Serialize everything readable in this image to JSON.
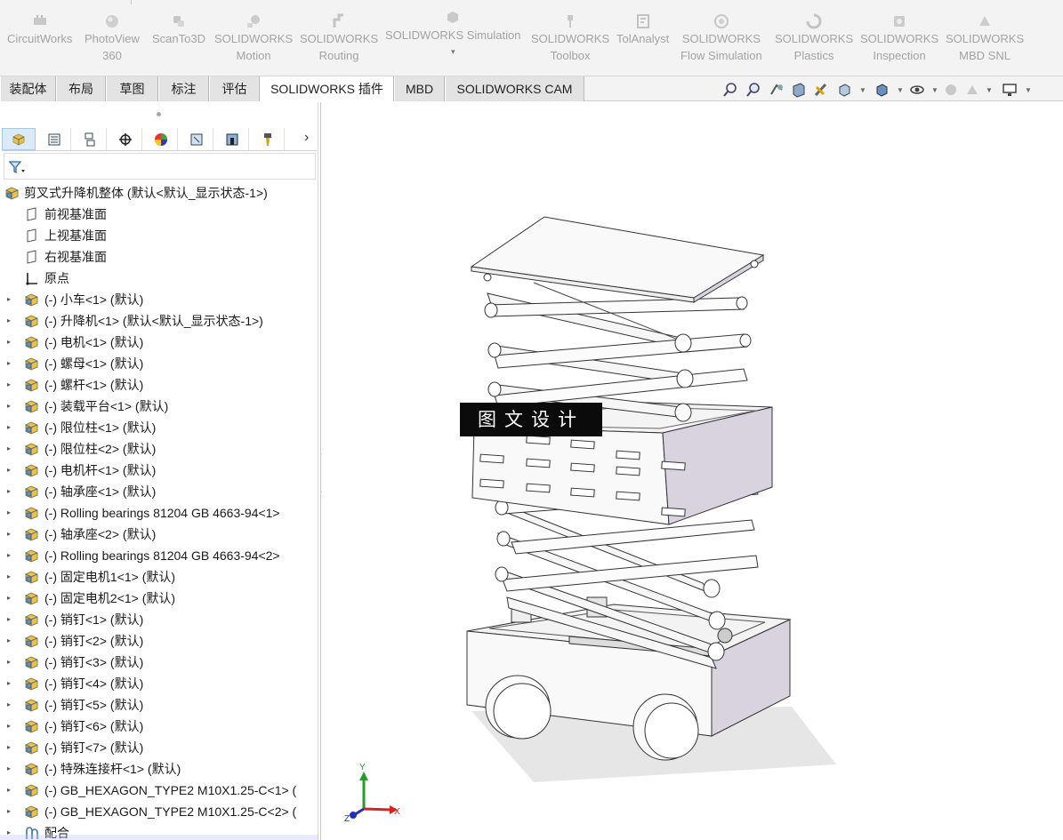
{
  "ribbon": {
    "addins": [
      {
        "line1": "CircuitWorks",
        "line2": ""
      },
      {
        "line1": "PhotoView",
        "line2": "360"
      },
      {
        "line1": "ScanTo3D",
        "line2": ""
      },
      {
        "line1": "SOLIDWORKS",
        "line2": "Motion"
      },
      {
        "line1": "SOLIDWORKS",
        "line2": "Routing"
      },
      {
        "line1": "SOLIDWORKS Simulation",
        "line2": ""
      },
      {
        "line1": "SOLIDWORKS",
        "line2": "Toolbox"
      },
      {
        "line1": "TolAnalyst",
        "line2": ""
      },
      {
        "line1": "SOLIDWORKS",
        "line2": "Flow Simulation"
      },
      {
        "line1": "SOLIDWORKS",
        "line2": "Plastics"
      },
      {
        "line1": "SOLIDWORKS",
        "line2": "Inspection"
      },
      {
        "line1": "SOLIDWORKS",
        "line2": "MBD SNL"
      }
    ],
    "simulation_caret": "▾"
  },
  "tabs": [
    {
      "label": "装配体"
    },
    {
      "label": "布局"
    },
    {
      "label": "草图"
    },
    {
      "label": "标注"
    },
    {
      "label": "评估"
    },
    {
      "label": "SOLIDWORKS 插件",
      "active": true
    },
    {
      "label": "MBD"
    },
    {
      "label": "SOLIDWORKS CAM"
    }
  ],
  "view_tools": [
    "zoom-to-fit-icon",
    "zoom-to-area-icon",
    "previous-view-icon",
    "section-view-icon",
    "dynamic-annotation-icon",
    "view-orientation-icon",
    "display-style-icon",
    "hide-show-items-icon",
    "edit-appearance-icon",
    "apply-scene-icon",
    "view-settings-icon"
  ],
  "feature_manager": {
    "tabs": [
      "feature-manager-icon",
      "property-manager-icon",
      "configuration-manager-icon",
      "dimxpert-icon",
      "display-manager-icon",
      "cam-feature-icon",
      "cam-operation-icon",
      "cam-tools-icon"
    ],
    "more": "›",
    "filter_caret": "▾",
    "root": "剪叉式升降机整体  (默认<默认_显示状态-1>)",
    "planes": [
      "前视基准面",
      "上视基准面",
      "右视基准面"
    ],
    "origin": "原点",
    "components": [
      "(-) 小车<1> (默认)",
      "(-) 升降机<1> (默认<默认_显示状态-1>)",
      "(-) 电机<1> (默认)",
      "(-) 螺母<1> (默认)",
      "(-) 螺杆<1> (默认)",
      "(-) 装载平台<1> (默认)",
      "(-) 限位柱<1> (默认)",
      "(-) 限位柱<2> (默认)",
      "(-) 电机杆<1> (默认)",
      "(-) 轴承座<1> (默认)",
      "(-) Rolling bearings 81204 GB 4663-94<1>",
      "(-) 轴承座<2> (默认)",
      "(-) Rolling bearings 81204 GB 4663-94<2>",
      "(-) 固定电机1<1> (默认)",
      "(-) 固定电机2<1> (默认)",
      "(-) 销钉<1> (默认)",
      "(-) 销钉<2> (默认)",
      "(-) 销钉<3> (默认)",
      "(-) 销钉<4> (默认)",
      "(-) 销钉<5> (默认)",
      "(-) 销钉<6> (默认)",
      "(-) 销钉<7> (默认)",
      "(-) 特殊连接杆<1> (默认)",
      "(-) GB_HEXAGON_TYPE2 M10X1.25-C<1> (",
      "(-) GB_HEXAGON_TYPE2 M10X1.25-C<2> ("
    ],
    "mates": "配合",
    "expander": "▸"
  },
  "graphics": {
    "watermark": "图文设计",
    "triad": {
      "x": "X",
      "y": "Y",
      "z": "Z"
    }
  },
  "colors": {
    "ribbon_bg": "#f3f3f3",
    "tab_active": "#ffffff",
    "model_panel": "#d9d3df",
    "triad_x": "#e02020",
    "triad_y": "#20a020",
    "triad_z": "#2030c0"
  }
}
